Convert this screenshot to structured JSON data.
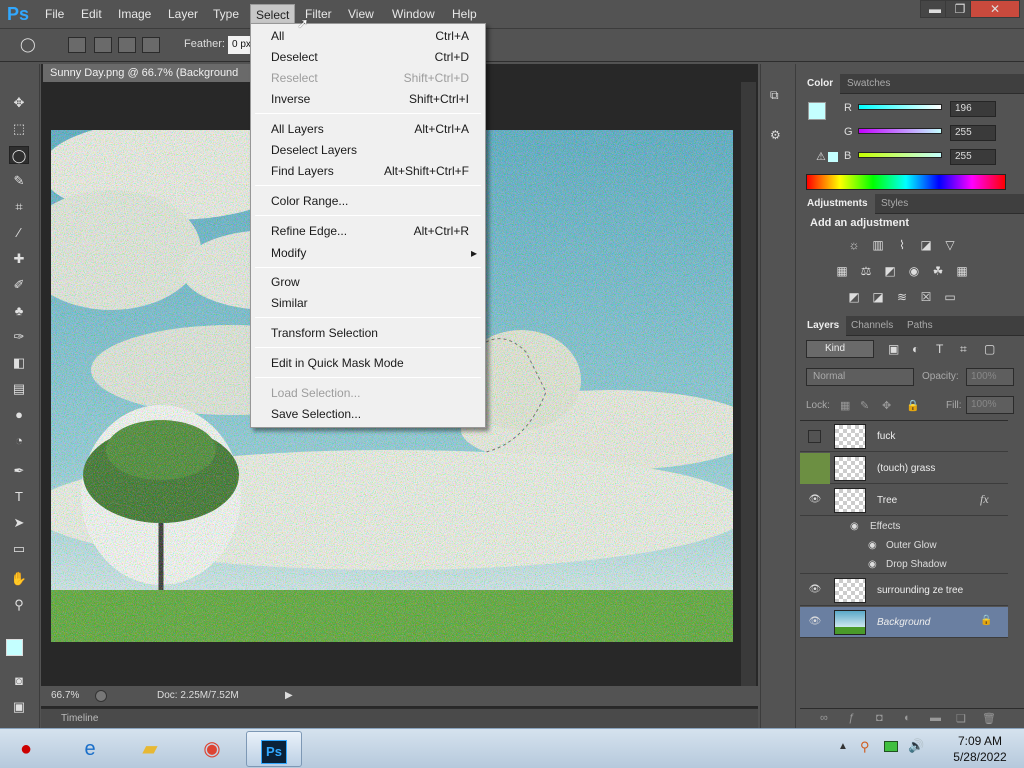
{
  "app": {
    "logo": "Ps"
  },
  "menubar": {
    "items": [
      "File",
      "Edit",
      "Image",
      "Layer",
      "Type",
      "Select",
      "Filter",
      "View",
      "Window",
      "Help"
    ],
    "active": "Select"
  },
  "window_controls": {
    "minimize": "▬",
    "restore": "❐",
    "close": "✕"
  },
  "options_bar": {
    "feather_label": "Feather:",
    "feather_value": "0 px"
  },
  "document": {
    "tab_title": "Sunny Day.png @ 66.7% (Background",
    "zoom": "66.7%",
    "doc_size": "Doc: 2.25M/7.52M",
    "timeline_label": "Timeline"
  },
  "select_menu": {
    "items": [
      {
        "label": "All",
        "shortcut": "Ctrl+A",
        "disabled": false
      },
      {
        "label": "Deselect",
        "shortcut": "Ctrl+D",
        "disabled": false
      },
      {
        "label": "Reselect",
        "shortcut": "Shift+Ctrl+D",
        "disabled": true
      },
      {
        "label": "Inverse",
        "shortcut": "Shift+Ctrl+I",
        "disabled": false
      },
      {
        "label": "All Layers",
        "shortcut": "Alt+Ctrl+A",
        "disabled": false
      },
      {
        "label": "Deselect Layers",
        "shortcut": "",
        "disabled": false
      },
      {
        "label": "Find Layers",
        "shortcut": "Alt+Shift+Ctrl+F",
        "disabled": false
      },
      {
        "label": "Color Range...",
        "shortcut": "",
        "disabled": false
      },
      {
        "label": "Refine Edge...",
        "shortcut": "Alt+Ctrl+R",
        "disabled": false
      },
      {
        "label": "Modify",
        "shortcut": "▸",
        "disabled": false
      },
      {
        "label": "Grow",
        "shortcut": "",
        "disabled": false
      },
      {
        "label": "Similar",
        "shortcut": "",
        "disabled": false
      },
      {
        "label": "Transform Selection",
        "shortcut": "",
        "disabled": false
      },
      {
        "label": "Edit in Quick Mask Mode",
        "shortcut": "",
        "disabled": false
      },
      {
        "label": "Load Selection...",
        "shortcut": "",
        "disabled": true
      },
      {
        "label": "Save Selection...",
        "shortcut": "",
        "disabled": false
      }
    ]
  },
  "color_panel": {
    "tabs": [
      "Color",
      "Swatches"
    ],
    "r_label": "R",
    "g_label": "G",
    "b_label": "B",
    "r": "196",
    "g": "255",
    "b": "255",
    "swatch_color": "#c4ffff"
  },
  "adjustments_panel": {
    "tabs": [
      "Adjustments",
      "Styles"
    ],
    "heading": "Add an adjustment"
  },
  "layers_panel": {
    "tabs": [
      "Layers",
      "Channels",
      "Paths"
    ],
    "filter_kind": "Kind",
    "blend_mode": "Normal",
    "opacity_label": "Opacity:",
    "opacity_value": "100%",
    "lock_label": "Lock:",
    "fill_label": "Fill:",
    "fill_value": "100%",
    "layers": [
      {
        "name": "fuck",
        "visible": false
      },
      {
        "name": "(touch) grass",
        "visible": false
      },
      {
        "name": "Tree",
        "visible": true,
        "fx": "fx"
      },
      {
        "name": "surrounding ze tree",
        "visible": true
      },
      {
        "name": "Background",
        "visible": true,
        "locked": true
      }
    ],
    "effects_label": "Effects",
    "effects": [
      "Outer Glow",
      "Drop Shadow"
    ]
  },
  "taskbar": {
    "time": "7:09 AM",
    "date": "5/28/2022",
    "ps_label": "Ps"
  }
}
